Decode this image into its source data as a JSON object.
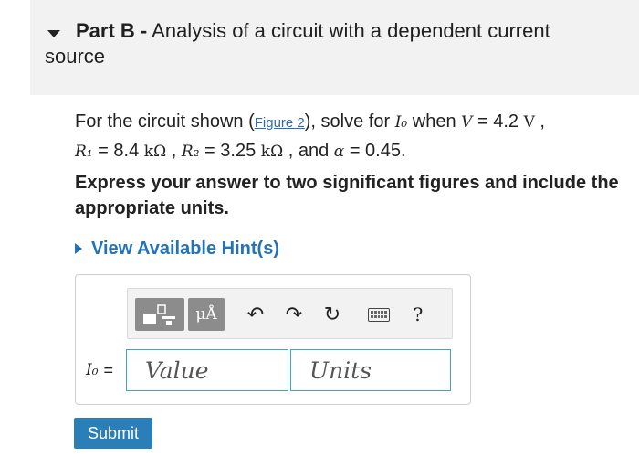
{
  "part": {
    "label": "Part B -",
    "title": "Analysis of a circuit with a dependent current source"
  },
  "question": {
    "text_before_link": "For the circuit shown (",
    "figure_link": "Figure 2",
    "text_after_link": "), solve for ",
    "target_var": "I₀",
    "when": " when ",
    "v_var": "V",
    "v_eq": " = 4.2 ",
    "v_unit": "V",
    "comma1": " ,",
    "r1_var": "R₁",
    "r1_eq": " = 8.4 ",
    "r1_unit": "kΩ",
    "comma2": " , ",
    "r2_var": "R₂",
    "r2_eq": " = 3.25 ",
    "r2_unit": "kΩ",
    "and": " , and ",
    "alpha_var": "α",
    "alpha_eq": " = 0.45."
  },
  "instruction": "Express your answer to two significant figures and include the appropriate units.",
  "hint": {
    "label": "View Available Hint(s)"
  },
  "toolbar": {
    "units_label": "μÅ",
    "undo_icon": "↶",
    "redo_icon": "↷",
    "reset_icon": "↻",
    "help_label": "?"
  },
  "answer": {
    "variable": "I₀",
    "equals": "=",
    "value_placeholder": "Value",
    "units_placeholder": "Units"
  },
  "submit_label": "Submit"
}
